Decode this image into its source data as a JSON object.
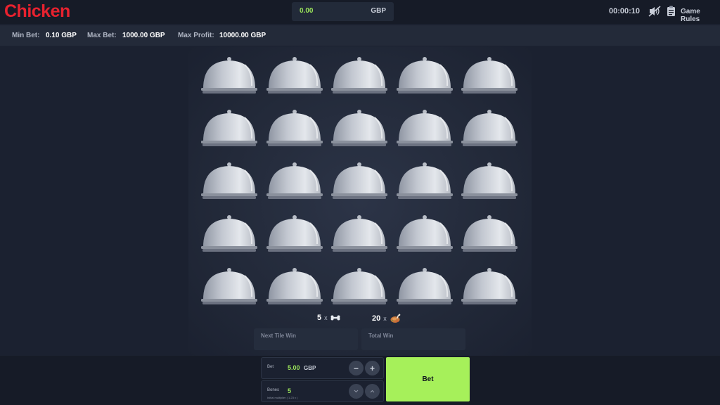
{
  "app": {
    "title": "Chicken",
    "brand_color": "#e8222f",
    "accent_color": "#a6f05a"
  },
  "header": {
    "balance_amount": "0.00",
    "balance_currency": "GBP",
    "timer": "00:00:10",
    "sound_icon": "sound-muted-icon",
    "rules_icon": "clipboard-icon",
    "rules_label": "Game Rules"
  },
  "limits": {
    "min_bet_label": "Min Bet:",
    "min_bet_value": "0.10 GBP",
    "max_bet_label": "Max Bet:",
    "max_bet_value": "1000.00 GBP",
    "max_profit_label": "Max Profit:",
    "max_profit_value": "10000.00 GBP"
  },
  "board": {
    "rows": 5,
    "columns": 5,
    "tile_icon": "cloche-icon"
  },
  "counts": {
    "bones_count": "5",
    "bones_x": "x",
    "bones_icon": "bone-icon",
    "chickens_count": "20",
    "chickens_x": "x",
    "chickens_icon": "chicken-icon"
  },
  "wins": {
    "next_tile_label": "Next Tile Win",
    "total_label": "Total Win"
  },
  "controls": {
    "bet_label": "Bet",
    "bet_value": "5.00",
    "bet_currency": "GBP",
    "decrease": "−",
    "increase": "+",
    "bones_label": "Bones",
    "bones_value": "5",
    "bones_hint": "Initial multiplier ( 1.23 x )",
    "bones_down_icon": "chevron-down-icon",
    "bones_up_icon": "chevron-up-icon",
    "bet_button_label": "Bet"
  }
}
